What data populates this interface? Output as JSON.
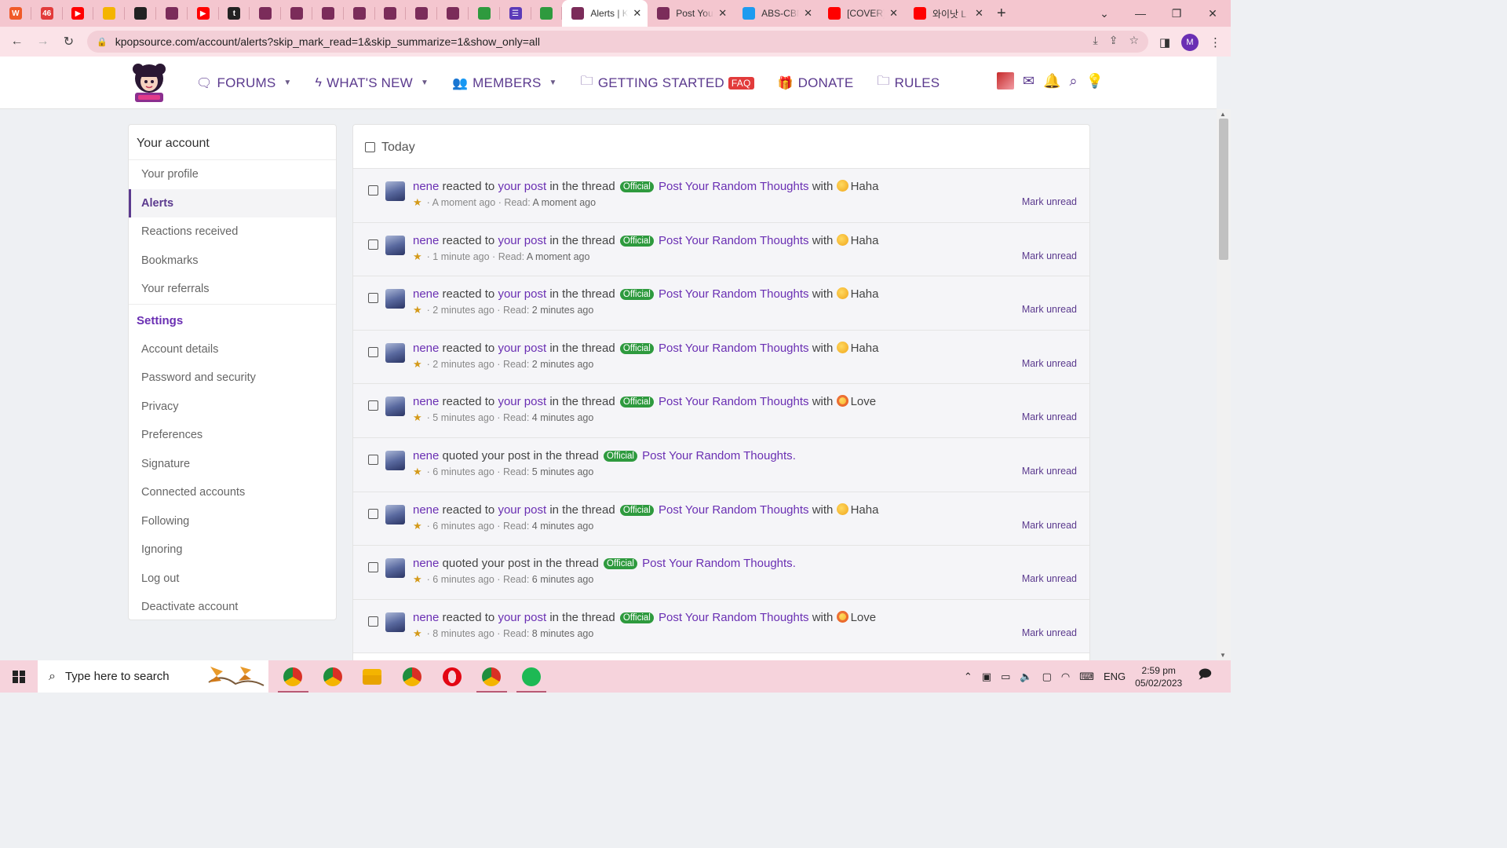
{
  "browser": {
    "pinned_tabs": [
      {
        "icon": "wattpad-icon",
        "color": "#f05a28",
        "label": "W"
      },
      {
        "icon": "badge-icon",
        "color": "#e23b3b",
        "label": "46"
      },
      {
        "icon": "youtube-icon",
        "color": "#ff0000",
        "label": "▶"
      },
      {
        "icon": "slides-icon",
        "color": "#f4b400",
        "label": ""
      },
      {
        "icon": "compass-icon",
        "color": "#222222",
        "label": ""
      },
      {
        "icon": "kpopsource-icon",
        "color": "#7b2c5a",
        "label": ""
      },
      {
        "icon": "youtube-icon",
        "color": "#ff0000",
        "label": "▶"
      },
      {
        "icon": "tumblr-icon",
        "color": "#222222",
        "label": "t"
      },
      {
        "icon": "kpopsource-icon",
        "color": "#7b2c5a",
        "label": ""
      },
      {
        "icon": "kpopsource-icon",
        "color": "#7b2c5a",
        "label": ""
      },
      {
        "icon": "kpopsource-icon",
        "color": "#7b2c5a",
        "label": ""
      },
      {
        "icon": "kpopsource-icon",
        "color": "#7b2c5a",
        "label": ""
      },
      {
        "icon": "kpopsource-icon",
        "color": "#7b2c5a",
        "label": ""
      },
      {
        "icon": "kpopsource-icon",
        "color": "#7b2c5a",
        "label": ""
      },
      {
        "icon": "kpopsource-icon",
        "color": "#7b2c5a",
        "label": ""
      },
      {
        "icon": "leaf-icon",
        "color": "#2e9a3e",
        "label": ""
      },
      {
        "icon": "list-icon",
        "color": "#5b3ab8",
        "label": "☰"
      },
      {
        "icon": "leaf-icon",
        "color": "#2e9a3e",
        "label": ""
      }
    ],
    "tabs": [
      {
        "title": "Alerts | K",
        "icon": "kpopsource-icon",
        "color": "#7b2c5a",
        "active": true
      },
      {
        "title": "Post You",
        "icon": "kpopsource-icon",
        "color": "#7b2c5a",
        "active": false
      },
      {
        "title": "ABS-CBN",
        "icon": "twitter-icon",
        "color": "#1d9bf0",
        "active": false
      },
      {
        "title": "[COVER]",
        "icon": "youtube-icon",
        "color": "#ff0000",
        "active": false
      },
      {
        "title": "와이낫 L",
        "icon": "youtube-icon",
        "color": "#ff0000",
        "active": false
      }
    ],
    "url": "kpopsource.com/account/alerts?skip_mark_read=1&skip_summarize=1&show_only=all",
    "profile_initial": "M"
  },
  "nav": {
    "forums": "FORUMS",
    "whats_new": "WHAT'S NEW",
    "members": "MEMBERS",
    "getting_started": "GETTING STARTED",
    "faq": "FAQ",
    "donate": "DONATE",
    "rules": "RULES"
  },
  "sidebar": {
    "heading": "Your account",
    "items": [
      "Your profile",
      "Alerts",
      "Reactions received",
      "Bookmarks",
      "Your referrals"
    ],
    "settings_heading": "Settings",
    "settings_items": [
      "Account details",
      "Password and security",
      "Privacy",
      "Preferences",
      "Signature",
      "Connected accounts",
      "Following",
      "Ignoring",
      "Log out",
      "Deactivate account"
    ]
  },
  "alerts": {
    "section": "Today",
    "mark_label": "Mark unread",
    "official": "Official",
    "rows": [
      {
        "user": "nene",
        "kind": "reacted",
        "reaction": "Haha",
        "time": "A moment ago",
        "read": "A moment ago"
      },
      {
        "user": "nene",
        "kind": "reacted",
        "reaction": "Haha",
        "time": "1 minute ago",
        "read": "A moment ago"
      },
      {
        "user": "nene",
        "kind": "reacted",
        "reaction": "Haha",
        "time": "2 minutes ago",
        "read": "2 minutes ago"
      },
      {
        "user": "nene",
        "kind": "reacted",
        "reaction": "Haha",
        "time": "2 minutes ago",
        "read": "2 minutes ago"
      },
      {
        "user": "nene",
        "kind": "reacted",
        "reaction": "Love",
        "time": "5 minutes ago",
        "read": "4 minutes ago"
      },
      {
        "user": "nene",
        "kind": "quoted",
        "reaction": "",
        "time": "6 minutes ago",
        "read": "5 minutes ago"
      },
      {
        "user": "nene",
        "kind": "reacted",
        "reaction": "Haha",
        "time": "6 minutes ago",
        "read": "4 minutes ago"
      },
      {
        "user": "nene",
        "kind": "quoted",
        "reaction": "",
        "time": "6 minutes ago",
        "read": "6 minutes ago"
      },
      {
        "user": "nene",
        "kind": "reacted",
        "reaction": "Love",
        "time": "8 minutes ago",
        "read": "8 minutes ago"
      }
    ],
    "text": {
      "reacted_to": "reacted to",
      "your_post": "your post",
      "in_thread": "in the thread",
      "quoted": "quoted your post in the thread",
      "thread": "Post Your Random Thoughts",
      "with": "with",
      "read": "Read:",
      "period": "."
    }
  },
  "taskbar": {
    "search_placeholder": "Type here to search",
    "apps": [
      {
        "icon": "chrome-icon",
        "color": "#d93025",
        "open": true
      },
      {
        "icon": "chrome-icon",
        "color": "#d93025",
        "open": false
      },
      {
        "icon": "file-explorer-icon",
        "color": "#f4b400",
        "open": false
      },
      {
        "icon": "chrome-icon",
        "color": "#d93025",
        "open": false
      },
      {
        "icon": "opera-icon",
        "color": "#e30613",
        "open": false
      },
      {
        "icon": "chrome-icon",
        "color": "#d93025",
        "open": true
      },
      {
        "icon": "spotify-icon",
        "color": "#1db954",
        "open": true
      }
    ],
    "lang": "ENG",
    "time": "2:59 pm",
    "date": "05/02/2023"
  }
}
